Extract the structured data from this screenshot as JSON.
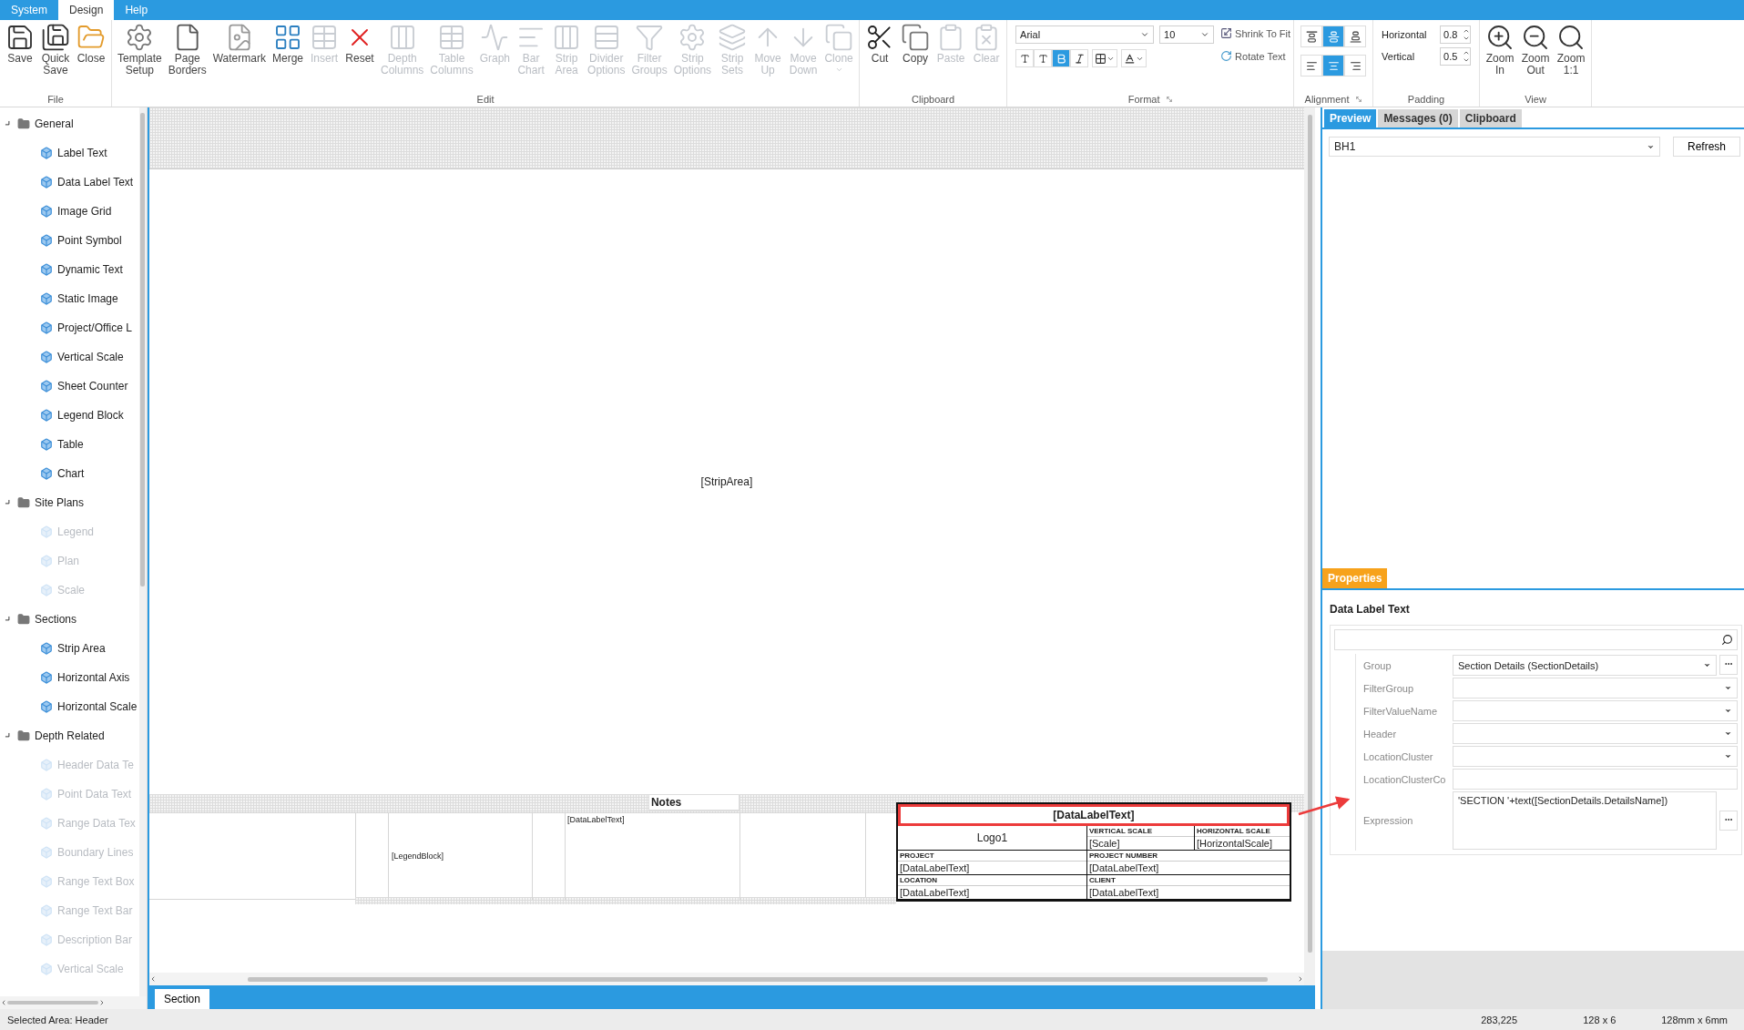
{
  "menu": [
    {
      "label": "System",
      "selected": false
    },
    {
      "label": "Design",
      "selected": true
    },
    {
      "label": "Help",
      "selected": false
    }
  ],
  "ribbon": [
    {
      "kind": "buttons",
      "label": "File",
      "buttons": [
        {
          "label": "Save",
          "disabled": false,
          "dropdown": false
        },
        {
          "label": "Quick Save",
          "disabled": false,
          "dropdown": false
        },
        {
          "label": "Close",
          "disabled": false,
          "dropdown": false
        }
      ]
    },
    {
      "kind": "buttons",
      "label": "Edit",
      "buttons": [
        {
          "label": "Template Setup",
          "disabled": false,
          "dropdown": false
        },
        {
          "label": "Page Borders",
          "disabled": false,
          "dropdown": false
        },
        {
          "label": "Watermark",
          "disabled": false,
          "dropdown": false
        },
        {
          "label": "Merge",
          "disabled": false,
          "dropdown": false
        },
        {
          "label": "Insert",
          "disabled": true,
          "dropdown": false
        },
        {
          "label": "Reset",
          "disabled": false,
          "dropdown": false
        },
        {
          "label": "Depth Columns",
          "disabled": true,
          "dropdown": false
        },
        {
          "label": "Table Columns",
          "disabled": true,
          "dropdown": false
        },
        {
          "label": "Graph",
          "disabled": true,
          "dropdown": false
        },
        {
          "label": "Bar Chart",
          "disabled": true,
          "dropdown": false
        },
        {
          "label": "Strip Area",
          "disabled": true,
          "dropdown": false
        },
        {
          "label": "Divider Options",
          "disabled": true,
          "dropdown": false
        },
        {
          "label": "Filter Groups",
          "disabled": true,
          "dropdown": false
        },
        {
          "label": "Strip Options",
          "disabled": true,
          "dropdown": false
        },
        {
          "label": "Strip Sets",
          "disabled": true,
          "dropdown": false
        },
        {
          "label": "Move Up",
          "disabled": true,
          "dropdown": false
        },
        {
          "label": "Move Down",
          "disabled": true,
          "dropdown": false
        },
        {
          "label": "Clone",
          "disabled": true,
          "dropdown": true
        }
      ]
    },
    {
      "kind": "buttons",
      "label": "Clipboard",
      "buttons": [
        {
          "label": "Cut",
          "disabled": false,
          "dropdown": false
        },
        {
          "label": "Copy",
          "disabled": false,
          "dropdown": false
        },
        {
          "label": "Paste",
          "disabled": true,
          "dropdown": false
        },
        {
          "label": "Clear",
          "disabled": true,
          "dropdown": false
        }
      ]
    },
    {
      "kind": "format",
      "label": "Format",
      "font": "Arial",
      "size": "10",
      "actions": [
        {
          "label": "Shrink To Fit"
        },
        {
          "label": "Rotate Text"
        }
      ],
      "styles": [
        {
          "selected": false
        },
        {
          "selected": false
        },
        {
          "selected": true
        },
        {
          "selected": false
        },
        {
          "selected": false
        },
        {
          "selected": false
        }
      ]
    },
    {
      "kind": "alignment",
      "label": "Alignment",
      "vertical": [
        {
          "selected": false
        },
        {
          "selected": true
        },
        {
          "selected": false
        }
      ],
      "horizontal": [
        {
          "selected": false
        },
        {
          "selected": true
        },
        {
          "selected": false
        }
      ]
    },
    {
      "kind": "padding",
      "label": "Padding",
      "fields": [
        {
          "label": "Horizontal",
          "value": "0.8"
        },
        {
          "label": "Vertical",
          "value": "0.5"
        }
      ]
    },
    {
      "kind": "buttons",
      "label": "View",
      "buttons": [
        {
          "label": "Zoom In",
          "disabled": false,
          "dropdown": false
        },
        {
          "label": "Zoom Out",
          "disabled": false,
          "dropdown": false
        },
        {
          "label": "Zoom 1:1",
          "disabled": false,
          "dropdown": false
        }
      ]
    }
  ],
  "sidebar": [
    {
      "label": "General",
      "expanded": true,
      "children": [
        {
          "label": "Label Text",
          "disabled": false
        },
        {
          "label": "Data Label Text",
          "disabled": false
        },
        {
          "label": "Image Grid",
          "disabled": false
        },
        {
          "label": "Point Symbol",
          "disabled": false
        },
        {
          "label": "Dynamic Text",
          "disabled": false
        },
        {
          "label": "Static Image",
          "disabled": false
        },
        {
          "label": "Project/Office L",
          "disabled": false
        },
        {
          "label": "Vertical Scale",
          "disabled": false
        },
        {
          "label": "Sheet Counter",
          "disabled": false
        },
        {
          "label": "Legend Block",
          "disabled": false
        },
        {
          "label": "Table",
          "disabled": false
        },
        {
          "label": "Chart",
          "disabled": false
        }
      ]
    },
    {
      "label": "Site Plans",
      "expanded": true,
      "children": [
        {
          "label": "Legend",
          "disabled": true
        },
        {
          "label": "Plan",
          "disabled": true
        },
        {
          "label": "Scale",
          "disabled": true
        }
      ]
    },
    {
      "label": "Sections",
      "expanded": true,
      "children": [
        {
          "label": "Strip Area",
          "disabled": false
        },
        {
          "label": "Horizontal Axis",
          "disabled": false
        },
        {
          "label": "Horizontal Scale",
          "disabled": false
        }
      ]
    },
    {
      "label": "Depth Related",
      "expanded": true,
      "children": [
        {
          "label": "Header Data Te",
          "disabled": true
        },
        {
          "label": "Point Data Text",
          "disabled": true
        },
        {
          "label": "Range Data Tex",
          "disabled": true
        },
        {
          "label": "Boundary Lines",
          "disabled": true
        },
        {
          "label": "Range Text Box",
          "disabled": true
        },
        {
          "label": "Range Text Bar",
          "disabled": true
        },
        {
          "label": "Description Bar",
          "disabled": true
        },
        {
          "label": "Vertical Scale",
          "disabled": true
        }
      ]
    }
  ],
  "canvas": {
    "strip_area": "[StripArea]",
    "notes": "Notes",
    "notes_field": "[DataLabelText]",
    "legend": "[LegendBlock]",
    "title_block": {
      "title": "[DataLabelText]",
      "selected": true,
      "logo": "Logo1",
      "cells": [
        {
          "label": "VERTICAL SCALE",
          "value": "[Scale]"
        },
        {
          "label": "HORIZONTAL SCALE",
          "value": "[HorizontalScale]"
        },
        {
          "label": "PROJECT",
          "value": "[DataLabelText]"
        },
        {
          "label": "PROJECT NUMBER",
          "value": "[DataLabelText]"
        },
        {
          "label": "LOCATION",
          "value": "[DataLabelText]"
        },
        {
          "label": "CLIENT",
          "value": "[DataLabelText]"
        }
      ]
    },
    "section_tab": "Section"
  },
  "panel": {
    "tabs": [
      {
        "label": "Preview",
        "selected": true
      },
      {
        "label": "Messages (0)",
        "selected": false
      },
      {
        "label": "Clipboard",
        "selected": false
      }
    ],
    "borehole": "BH1",
    "refresh": "Refresh",
    "properties": {
      "tab": "Properties",
      "title": "Data Label Text",
      "rows": [
        {
          "label": "Group",
          "kind": "dropdown",
          "value": "Section Details (SectionDetails)",
          "more": true
        },
        {
          "label": "FilterGroup",
          "kind": "dropdown",
          "more": false
        },
        {
          "label": "FilterValueName",
          "kind": "dropdown",
          "more": false
        },
        {
          "label": "Header",
          "kind": "dropdown",
          "more": false
        },
        {
          "label": "LocationCluster",
          "kind": "dropdown",
          "more": false
        },
        {
          "label": "LocationClusterCo",
          "kind": "text",
          "more": false
        },
        {
          "label": "Expression",
          "kind": "multiline",
          "value": "'SECTION '+text([SectionDetails.DetailsName])",
          "more": true
        }
      ]
    }
  },
  "status_bar": [
    "Selected Area: Header",
    "283,225",
    "128 x 6",
    "128mm x 6mm"
  ]
}
